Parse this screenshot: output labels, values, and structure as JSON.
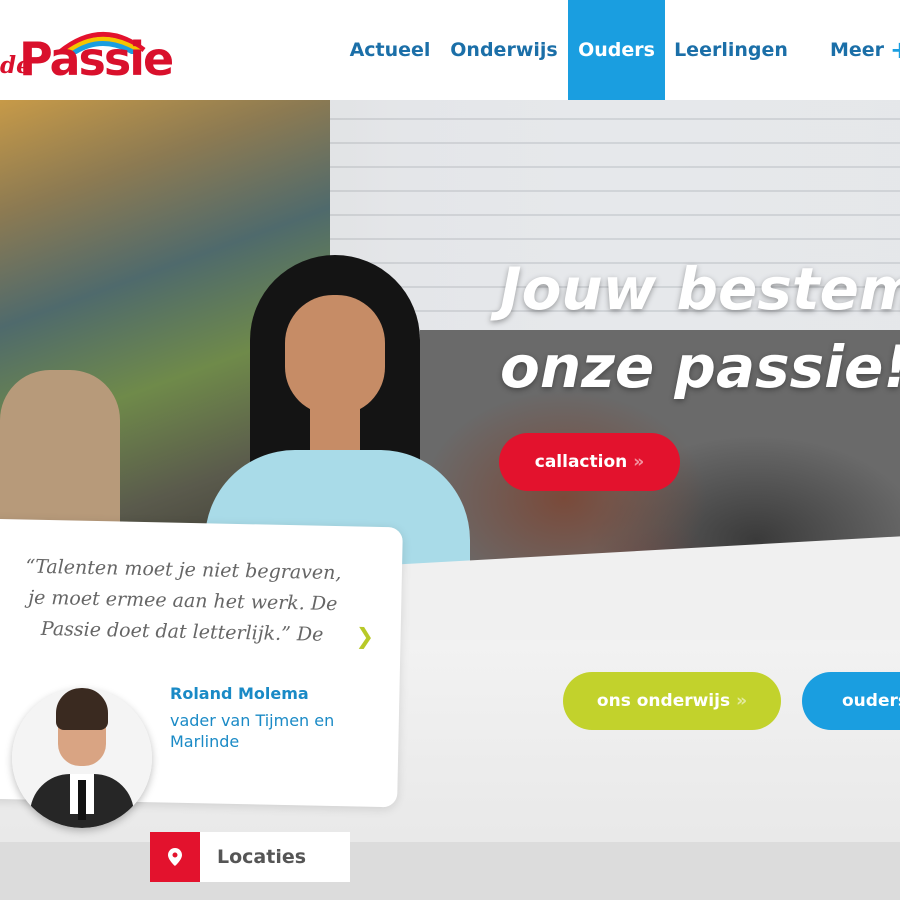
{
  "logo": {
    "prefix": "de",
    "name": "Passie"
  },
  "nav": {
    "items": [
      {
        "label": "Actueel"
      },
      {
        "label": "Onderwijs"
      },
      {
        "label": "Ouders"
      },
      {
        "label": "Leerlingen"
      },
      {
        "label": "Meer"
      }
    ],
    "active": "Ouders",
    "more_icon": "+"
  },
  "hero": {
    "headline_line1": "Jouw bestem",
    "headline_line2": "onze passie!",
    "cta_label": "callaction",
    "onderwijs_label": "ons onderwijs",
    "ouders_label": "ouders",
    "arrow": "»"
  },
  "testimonial": {
    "quote": "“Talenten moet je niet begraven, je moet ermee aan het werk. De Passie doet dat letterlijk.” De",
    "next_icon": "chevron-right-icon",
    "name": "Roland Molema",
    "role": "vader van Tijmen en Marlinde"
  },
  "locations": {
    "label": "Locaties",
    "icon": "map-pin-icon"
  },
  "colors": {
    "red": "#e3122d",
    "blue": "#1a9ee0",
    "green": "#c2d22c",
    "navy": "#1b6fa8"
  }
}
